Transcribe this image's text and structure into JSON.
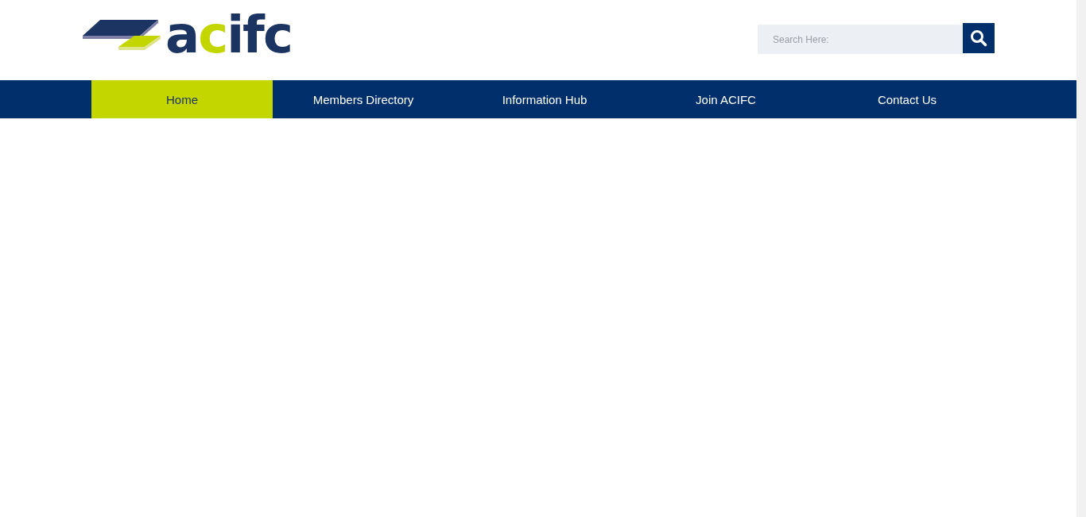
{
  "logo": {
    "letters": [
      {
        "text": "a",
        "color": "#1c3461"
      },
      {
        "text": "c",
        "color": "#c4d600"
      },
      {
        "text": "ifc",
        "color": "#1c3461"
      }
    ]
  },
  "search": {
    "placeholder": "Search Here:"
  },
  "nav": [
    {
      "label": "Home",
      "selected": true
    },
    {
      "label": "Members Directory",
      "selected": false
    },
    {
      "label": "Information Hub",
      "selected": false
    },
    {
      "label": "Join ACIFC",
      "selected": false
    },
    {
      "label": "Contact Us",
      "selected": false
    }
  ]
}
